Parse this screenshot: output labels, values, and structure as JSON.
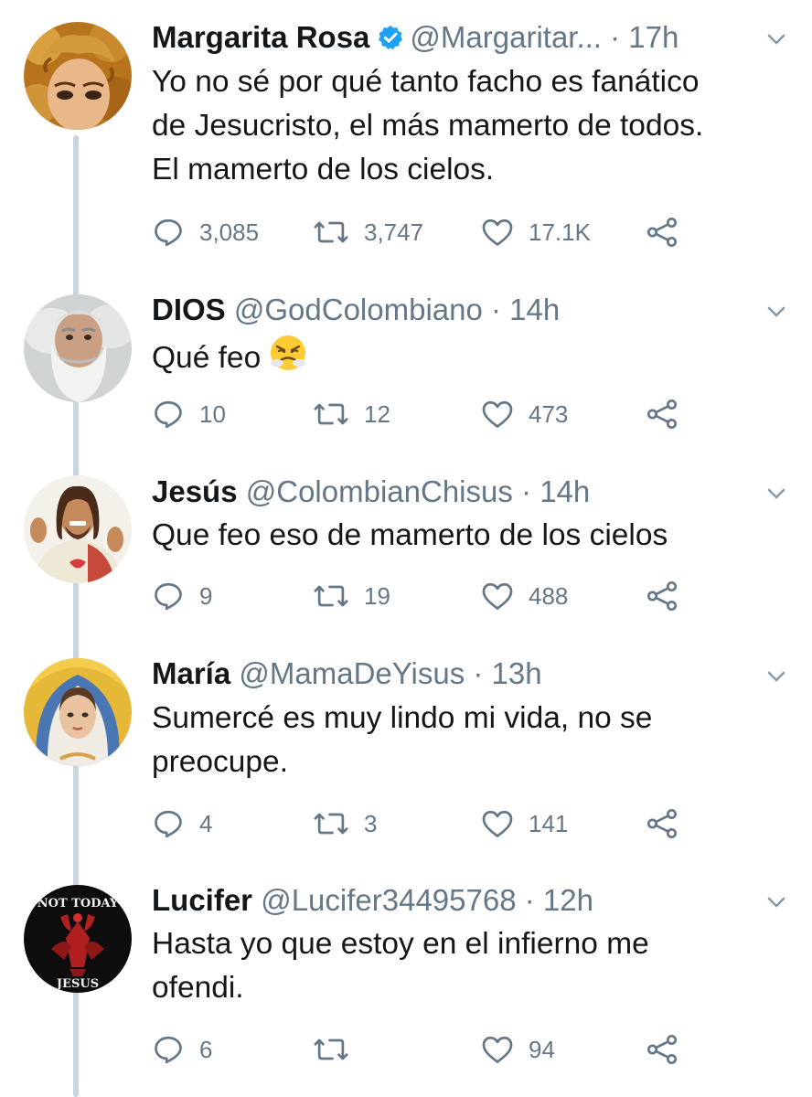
{
  "tweets": [
    {
      "name": "Margarita Rosa",
      "handle": "@Margaritar...",
      "time": " · 17h",
      "verified": true,
      "lines": [
        "Yo no sé por qué tanto facho es fanático",
        "de Jesucristo, el más mamerto de todos.",
        "El mamerto de los cielos."
      ],
      "replies": "3,085",
      "retweets": "3,747",
      "likes": "17.1K",
      "avatar_icon": "curly-hair-woman-avatar"
    },
    {
      "name": "DIOS",
      "handle": "@GodColombiano",
      "time": " · 14h",
      "lines": [
        "Qué feo"
      ],
      "emoji": "angry-face-emoji",
      "replies": "10",
      "retweets": "12",
      "likes": "473",
      "avatar_icon": "bearded-god-avatar"
    },
    {
      "name": "Jesús",
      "handle": "@ColombianChisus",
      "time": " · 14h",
      "lines": [
        "Que feo eso de mamerto de los cielos"
      ],
      "replies": "9",
      "retweets": "19",
      "likes": "488",
      "avatar_icon": "jesus-thumbs-up-avatar"
    },
    {
      "name": "María",
      "handle": "@MamaDeYisus",
      "time": " · 13h",
      "lines": [
        "Sumercé es muy lindo mi vida, no se",
        "preocupe."
      ],
      "replies": "4",
      "retweets": "3",
      "likes": "141",
      "avatar_icon": "virgin-mary-avatar"
    },
    {
      "name": "Lucifer",
      "handle": "@Lucifer34495768",
      "time": " · 12h",
      "lines": [
        "Hasta yo que estoy en el infierno me",
        "ofendi."
      ],
      "replies": "6",
      "retweets": "",
      "likes": "94",
      "avatar_icon": "baphomet-avatar",
      "avatar_text_top": "NOT TODAY",
      "avatar_text_bottom": "JESUS"
    }
  ],
  "colors": {
    "text": "#14171a",
    "secondary": "#657786",
    "thread_line": "#c9d4dc",
    "verified": "#1da1f2"
  }
}
